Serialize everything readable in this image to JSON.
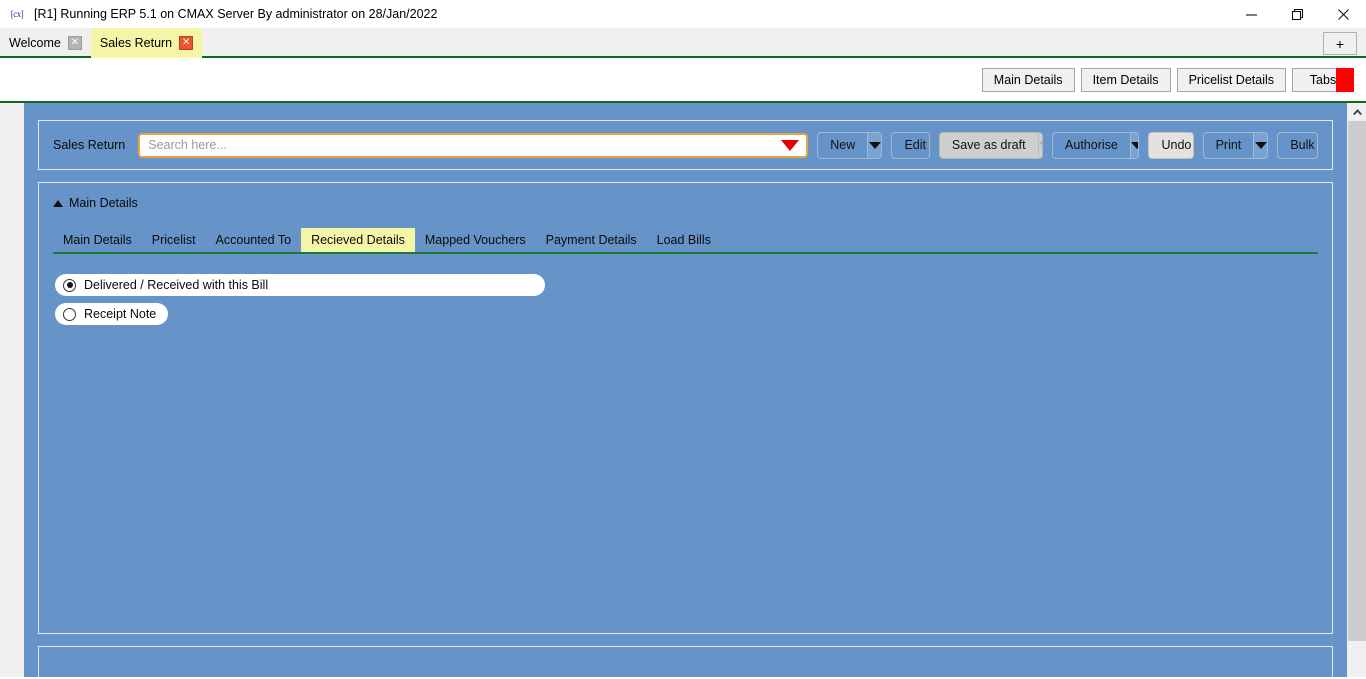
{
  "window": {
    "app_icon": "cx-logo-icon",
    "title": "[R1] Running ERP 5.1 on CMAX Server By administrator on 28/Jan/2022",
    "minimize_label": "minimize-icon",
    "maximize_label": "maximize-icon",
    "close_label": "close-icon"
  },
  "tabbar": {
    "tabs": [
      {
        "label": "Welcome",
        "active": false,
        "close": "✕"
      },
      {
        "label": "Sales Return",
        "active": true,
        "close": "✕"
      }
    ],
    "add_label": "+"
  },
  "subtoolbar": {
    "buttons": [
      {
        "label": "Main Details"
      },
      {
        "label": "Item Details"
      },
      {
        "label": "Pricelist Details"
      },
      {
        "label": "Tabs"
      }
    ],
    "marker_color": "#fe0000"
  },
  "panel": {
    "form_label": "Sales Return",
    "search": {
      "value": "",
      "placeholder": "Search here...",
      "dropdown_icon": "caret-down-icon"
    },
    "actions": [
      {
        "label": "New",
        "style": "split",
        "dropdown": true
      },
      {
        "label": "Edit",
        "style": "plain",
        "dropdown": false
      },
      {
        "label": "Save as draft",
        "style": "gray",
        "dropdown": true
      },
      {
        "label": "Authorise",
        "style": "split",
        "dropdown": true
      },
      {
        "label": "Undo",
        "style": "light",
        "dropdown": false
      },
      {
        "label": "Print",
        "style": "split",
        "dropdown": true
      },
      {
        "label": "Bulk",
        "style": "plain",
        "dropdown": false
      }
    ]
  },
  "section": {
    "title": "Main Details",
    "collapse_icon": "triangle-up-icon",
    "tabs": [
      {
        "label": "Main Details",
        "active": false
      },
      {
        "label": "Pricelist",
        "active": false
      },
      {
        "label": "Accounted To",
        "active": false
      },
      {
        "label": "Recieved Details",
        "active": true
      },
      {
        "label": "Mapped Vouchers",
        "active": false
      },
      {
        "label": "Payment Details",
        "active": false
      },
      {
        "label": "Load Bills",
        "active": false
      }
    ]
  },
  "received_details": {
    "options": [
      {
        "label": "Delivered / Received with this Bill",
        "selected": true
      },
      {
        "label": "Receipt Note",
        "selected": false
      }
    ]
  },
  "scrollbar": {
    "up_arrow": "chevron-up-icon"
  },
  "colors": {
    "panel_blue": "#6694c8",
    "accent_green": "#14691e",
    "active_tab_yellow": "#f5f5a8",
    "search_border": "#e8a33d",
    "marker_red": "#fe0000"
  }
}
